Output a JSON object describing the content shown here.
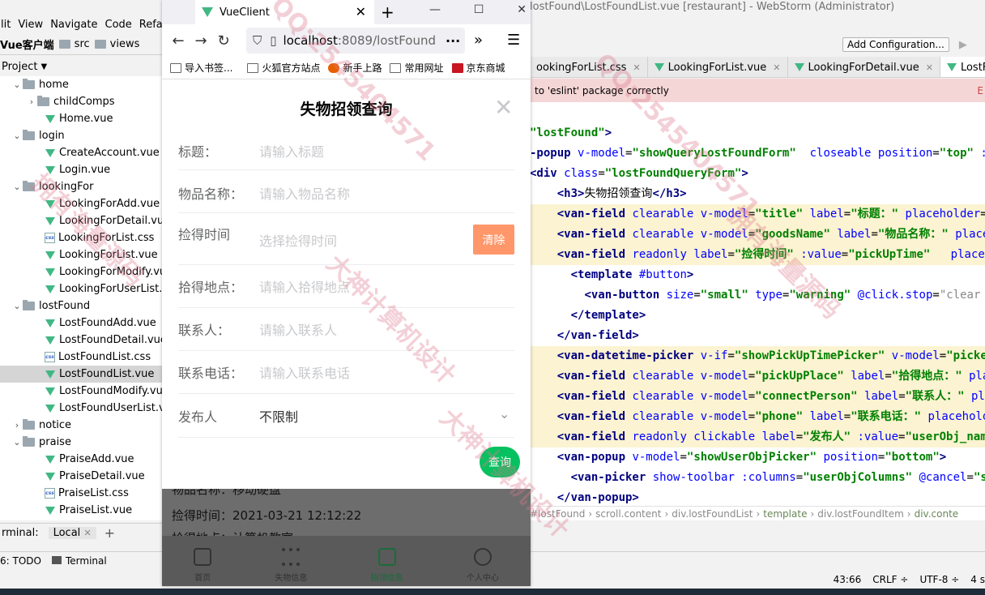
{
  "ide": {
    "title_right": "lostFound\\LostFoundList.vue [restaurant] - WebStorm (Administrator)",
    "menu": [
      "lit",
      "View",
      "Navigate",
      "Code",
      "Refac"
    ],
    "path": [
      "Vue客户端",
      "src",
      "views"
    ],
    "project_label": "Project",
    "add_config": "Add Configuration...",
    "warning": "to 'eslint' package correctly",
    "tree": [
      {
        "label": "home",
        "type": "folder",
        "level": 1,
        "open": true
      },
      {
        "label": "childComps",
        "type": "folder",
        "level": 2,
        "open": false
      },
      {
        "label": "Home.vue",
        "type": "vue",
        "level": 2
      },
      {
        "label": "login",
        "type": "folder",
        "level": 1,
        "open": true
      },
      {
        "label": "CreateAccount.vue",
        "type": "vue",
        "level": 2
      },
      {
        "label": "Login.vue",
        "type": "vue",
        "level": 2
      },
      {
        "label": "lookingFor",
        "type": "folder",
        "level": 1,
        "open": true
      },
      {
        "label": "LookingForAdd.vue",
        "type": "vue",
        "level": 2
      },
      {
        "label": "LookingForDetail.vue",
        "type": "vue",
        "level": 2
      },
      {
        "label": "LookingForList.css",
        "type": "css",
        "level": 2
      },
      {
        "label": "LookingForList.vue",
        "type": "vue",
        "level": 2
      },
      {
        "label": "LookingForModify.vue",
        "type": "vue",
        "level": 2
      },
      {
        "label": "LookingForUserList.vue",
        "type": "vue",
        "level": 2
      },
      {
        "label": "lostFound",
        "type": "folder",
        "level": 1,
        "open": true
      },
      {
        "label": "LostFoundAdd.vue",
        "type": "vue",
        "level": 2
      },
      {
        "label": "LostFoundDetail.vue",
        "type": "vue",
        "level": 2
      },
      {
        "label": "LostFoundList.css",
        "type": "css",
        "level": 2
      },
      {
        "label": "LostFoundList.vue",
        "type": "vue",
        "level": 2,
        "selected": true
      },
      {
        "label": "LostFoundModify.vue",
        "type": "vue",
        "level": 2
      },
      {
        "label": "LostFoundUserList.vue",
        "type": "vue",
        "level": 2
      },
      {
        "label": "notice",
        "type": "folder",
        "level": 1,
        "open": false
      },
      {
        "label": "praise",
        "type": "folder",
        "level": 1,
        "open": true
      },
      {
        "label": "PraiseAdd.vue",
        "type": "vue",
        "level": 2
      },
      {
        "label": "PraiseDetail.vue",
        "type": "vue",
        "level": 2
      },
      {
        "label": "PraiseList.css",
        "type": "css",
        "level": 2
      },
      {
        "label": "PraiseList.vue",
        "type": "vue",
        "level": 2
      }
    ],
    "terminal_label": "rminal:",
    "terminal_tab": "Local",
    "todo": "6: TODO",
    "terminal_btn": "Terminal",
    "tabs": [
      {
        "label": "ookingForList.css",
        "active": false
      },
      {
        "label": "LookingForList.vue",
        "active": false
      },
      {
        "label": "LookingForDetail.vue",
        "active": false
      },
      {
        "label": "LostFound",
        "active": true
      }
    ],
    "breadcrumbs": [
      "#lostFound",
      "scroll.content",
      "div.lostFoundList",
      "template",
      "div.lostFoundItem",
      "div.conte"
    ],
    "status": [
      "43:66",
      "CRLF ÷",
      "UTF-8 ÷",
      "4 s"
    ]
  },
  "browser": {
    "tab_title": "VueClient",
    "url_host": "localhost",
    "url_path": ":8089/lostFound",
    "bookmarks": [
      "导入书签...",
      "火狐官方站点",
      "新手上路",
      "常用网址",
      "京东商城"
    ]
  },
  "form": {
    "title": "失物招领查询",
    "fields": [
      {
        "label": "标题：",
        "value": "请输入标题",
        "placeholder": true
      },
      {
        "label": "物品名称：",
        "value": "请输入物品名称",
        "placeholder": true
      },
      {
        "label": "捡得时间",
        "value": "选择捡得时间",
        "placeholder": true
      },
      {
        "label": "拾得地点：",
        "value": "请输入拾得地点",
        "placeholder": true
      },
      {
        "label": "联系人：",
        "value": "请输入联系人",
        "placeholder": true
      },
      {
        "label": "联系电话：",
        "value": "请输入联系电话",
        "placeholder": true
      },
      {
        "label": "发布人",
        "value": "不限制",
        "placeholder": false
      }
    ],
    "clear_btn": "清除",
    "query_btn": "查询"
  },
  "list_behind": {
    "line1": "物品名称：移动硬盘",
    "line2": "捡得时间：2021-03-21 12:12:22",
    "line3": "拾得地点：计算机教室"
  },
  "bottom_nav": [
    "首页",
    "失物信息",
    "招领信息",
    "个人中心"
  ],
  "watermarks": [
    "拥有海量源码",
    "QQ:2545404571",
    "大神计算机设计"
  ]
}
